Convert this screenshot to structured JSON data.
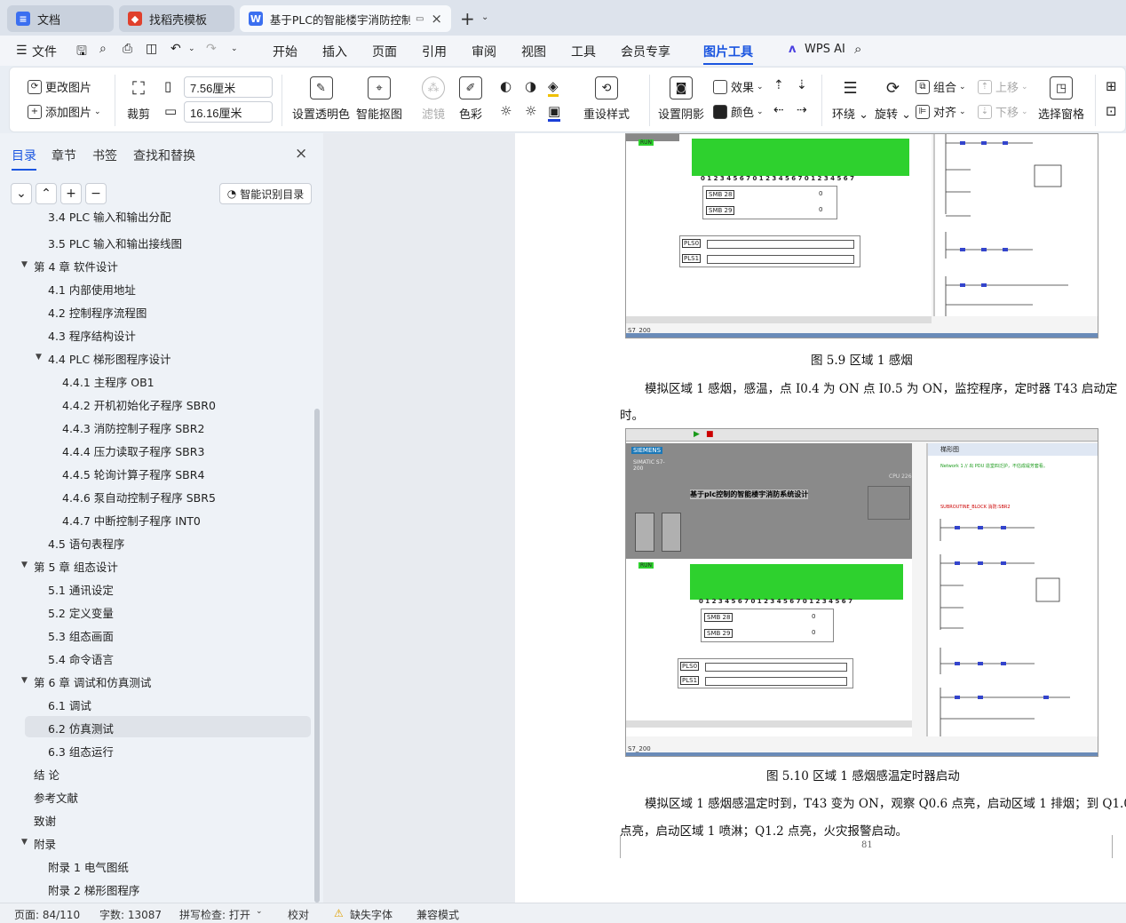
{
  "tabs": [
    {
      "label": "文档",
      "icon": "doc-icon",
      "color": "#3b6ff0"
    },
    {
      "label": "找稻壳模板",
      "icon": "docer-icon",
      "color": "#e0402c"
    },
    {
      "label": "基于PLC的智能楼宇消防控制:",
      "icon": "word-icon",
      "color": "#3b6ff0"
    }
  ],
  "menu": {
    "file": "文件",
    "items": [
      "开始",
      "插入",
      "页面",
      "引用",
      "审阅",
      "视图",
      "工具",
      "会员专享",
      "图片工具"
    ],
    "active": "图片工具",
    "ai": "WPS AI"
  },
  "ribbon": {
    "change_image": "更改图片",
    "add_image": "添加图片",
    "crop": "裁剪",
    "width": "7.56厘米",
    "height": "16.16厘米",
    "set_transparent": "设置透明色",
    "smart_cutout": "智能抠图",
    "filter": "滤镜",
    "color": "色彩",
    "reset_style": "重设样式",
    "set_shadow": "设置阴影",
    "effect": "效果",
    "color2": "颜色",
    "wrap": "环绕",
    "rotate": "旋转",
    "group": "组合",
    "align": "对齐",
    "bring_forward": "上移",
    "send_backward": "下移",
    "selection_pane": "选择窗格"
  },
  "nav": {
    "tabs": [
      "目录",
      "章节",
      "书签",
      "查找和替换"
    ],
    "smart_toc": "智能识别目录"
  },
  "toc": [
    {
      "label": "3.4   PLC 输入和输出分配",
      "level": 2
    },
    {
      "label": "3.5   PLC 输入和输出接线图",
      "level": 2
    },
    {
      "label": "第 4 章    软件设计",
      "level": 1,
      "expanded": true
    },
    {
      "label": "4.1   内部使用地址",
      "level": 2
    },
    {
      "label": "4.2   控制程序流程图",
      "level": 2
    },
    {
      "label": "4.3   程序结构设计",
      "level": 2
    },
    {
      "label": "4.4   PLC 梯形图程序设计",
      "level": 2,
      "expanded": true
    },
    {
      "label": "4.4.1  主程序 OB1",
      "level": 3
    },
    {
      "label": "4.4.2  开机初始化子程序 SBR0",
      "level": 3
    },
    {
      "label": "4.4.3  消防控制子程序 SBR2",
      "level": 3
    },
    {
      "label": "4.4.4  压力读取子程序 SBR3",
      "level": 3
    },
    {
      "label": "4.4.5  轮询计算子程序 SBR4",
      "level": 3
    },
    {
      "label": "4.4.6    泵自动控制子程序 SBR5",
      "level": 3
    },
    {
      "label": "4.4.7    中断控制子程序 INT0",
      "level": 3
    },
    {
      "label": "4.5   语句表程序",
      "level": 2
    },
    {
      "label": "第 5 章  组态设计",
      "level": 1,
      "expanded": true
    },
    {
      "label": "5.1   通讯设定",
      "level": 2
    },
    {
      "label": "5.2   定义变量",
      "level": 2
    },
    {
      "label": "5.3   组态画面",
      "level": 2
    },
    {
      "label": "5.4   命令语言",
      "level": 2
    },
    {
      "label": "第 6 章    调试和仿真测试",
      "level": 1,
      "expanded": true
    },
    {
      "label": "6.1   调试",
      "level": 2
    },
    {
      "label": "6.2   仿真测试",
      "level": 2,
      "selected": true
    },
    {
      "label": "6.3   组态运行",
      "level": 2
    },
    {
      "label": "结   论",
      "level": 1
    },
    {
      "label": "参考文献",
      "level": 1
    },
    {
      "label": "致谢",
      "level": 1
    },
    {
      "label": "附录",
      "level": 1,
      "expanded": true
    },
    {
      "label": "附录 1    电气图纸",
      "level": 2
    },
    {
      "label": "附录 2    梯形图程序",
      "level": 2
    }
  ],
  "doc": {
    "fig1_caption": "图 5.9  区域 1 感烟",
    "para1_line1": "模拟区域 1 感烟，感温，点 I0.4 为 ON 点 I0.5 为 ON，监控程序，定时器 T43 启动定",
    "para1_line2": "时。",
    "fig2_caption": "图 5.10 区域 1 感烟感温定时器启动",
    "para2_line1": "模拟区域 1 感烟感温定时到，T43 变为 ON，观察 Q0.6 点亮，启动区域 1 排烟；到 Q1.0",
    "para2_line2": "点亮，启动区域 1 喷淋；Q1.2 点亮，火灾报警启动。",
    "page_number": "81",
    "sim_title": "基于plc控制的智能楼宇消防系统设计",
    "sim_brand": "SIEMENS",
    "sim_model": "SIMATIC S7-200",
    "sim_cpu": "CPU 226",
    "sim_smb28": "SMB 28",
    "sim_smb29": "SMB 29",
    "sim_pls0": "PLS0",
    "sim_pls1": "PLS1",
    "sim_run": "RUN",
    "sim_status": "S7_200",
    "sim_ladder_title": "梯形图",
    "sim_subroutine": "SUBROUTINE_BLOCK 消防:SBR2",
    "sim_net1_note": "Network 1 // 出 PDU 造堂四泛护，不估成堤芳套看。",
    "sim_value": "0",
    "sim_digits": "0 1 2 3 4 5 6 7 0 1 2 3 4   5 6 7 0 1 2 3 4 5 6 7"
  },
  "status": {
    "page": "页面: 84/110",
    "words": "字数: 13087",
    "spell": "拼写检查: 打开",
    "proof": "校对",
    "missing_font": "缺失字体",
    "compat": "兼容模式"
  }
}
